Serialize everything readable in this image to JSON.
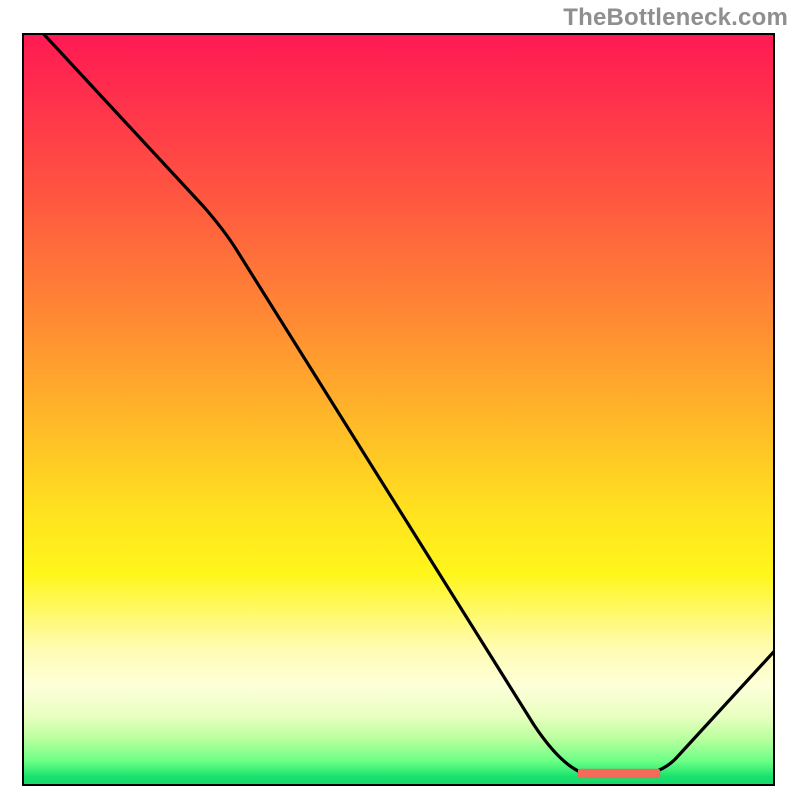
{
  "watermark": {
    "text": "TheBottleneck.com"
  },
  "chart_data": {
    "type": "line",
    "title": "",
    "xlabel": "",
    "ylabel": "",
    "xlim": [
      0,
      100
    ],
    "ylim": [
      0,
      100
    ],
    "series": [
      {
        "name": "curve",
        "points": [
          {
            "x": 2,
            "y": 100
          },
          {
            "x": 24,
            "y": 77
          },
          {
            "x": 27,
            "y": 73
          },
          {
            "x": 68,
            "y": 8
          },
          {
            "x": 72,
            "y": 3
          },
          {
            "x": 75,
            "y": 1.2
          },
          {
            "x": 82,
            "y": 1.2
          },
          {
            "x": 85,
            "y": 2.5
          },
          {
            "x": 100,
            "y": 19
          }
        ]
      }
    ],
    "markers": [
      {
        "name": "bottom-highlight",
        "x_start": 74,
        "x_end": 85,
        "y": 1.4,
        "color": "#ff6f5c"
      }
    ],
    "gradient_stops": [
      {
        "pos": 0.0,
        "color": "#ff1a54"
      },
      {
        "pos": 0.5,
        "color": "#ffd224"
      },
      {
        "pos": 0.85,
        "color": "#fdffd0"
      },
      {
        "pos": 1.0,
        "color": "#16d96a"
      }
    ],
    "grid": false,
    "legend": false
  }
}
